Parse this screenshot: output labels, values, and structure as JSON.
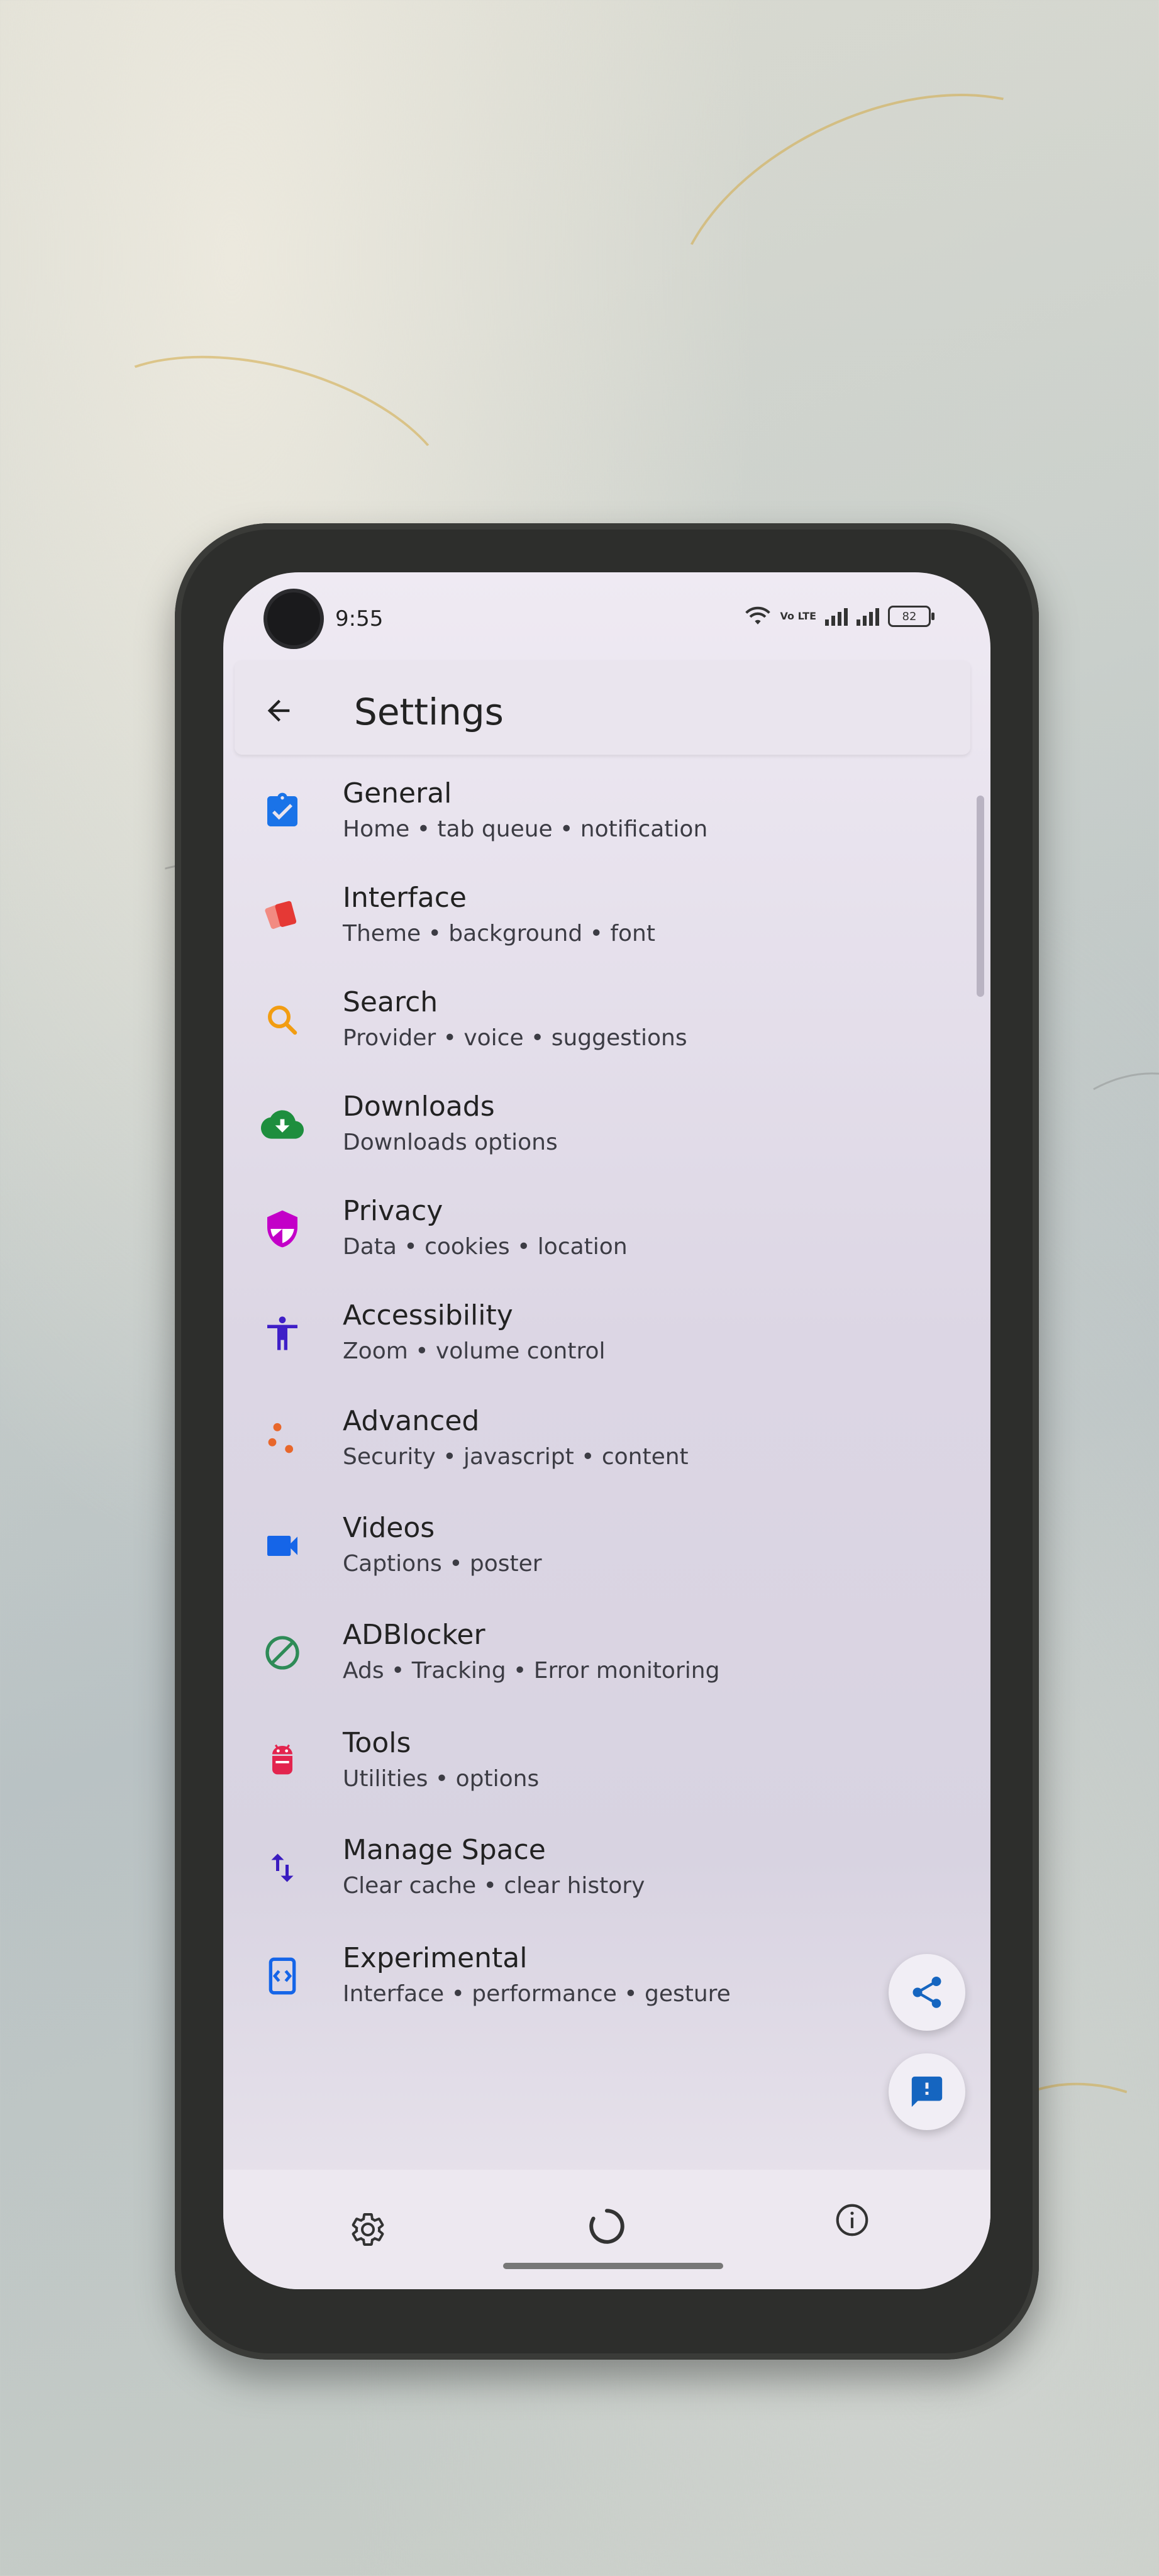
{
  "status_bar": {
    "time": "9:55",
    "network_label": "Vo LTE",
    "battery": "82"
  },
  "app_bar": {
    "title": "Settings",
    "back_icon": "arrow-back-icon"
  },
  "settings_items": [
    {
      "label": "General",
      "subtitle": "Home • tab queue • notification",
      "icon": "clipboard-check-icon",
      "color": "#1a73e8"
    },
    {
      "label": "Interface",
      "subtitle": "Theme • background • font",
      "icon": "palette-cards-icon",
      "color": "#e53935"
    },
    {
      "label": "Search",
      "subtitle": "Provider • voice • suggestions",
      "icon": "search-icon",
      "color": "#f29d12"
    },
    {
      "label": "Downloads",
      "subtitle": "Downloads options",
      "icon": "cloud-download-icon",
      "color": "#1e8e3e"
    },
    {
      "label": "Privacy",
      "subtitle": "Data • cookies • location",
      "icon": "shield-icon",
      "color": "#c300c8"
    },
    {
      "label": "Accessibility",
      "subtitle": "Zoom • volume control",
      "icon": "accessibility-icon",
      "color": "#3f1fc7"
    },
    {
      "label": "Advanced",
      "subtitle": "Security • javascript • content",
      "icon": "dots-icon",
      "color": "#e8672b"
    },
    {
      "label": "Videos",
      "subtitle": "Captions • poster",
      "icon": "videocam-icon",
      "color": "#1565e8"
    },
    {
      "label": "ADBlocker",
      "subtitle": "Ads • Tracking • Error monitoring",
      "icon": "block-icon",
      "color": "#2e8b57"
    },
    {
      "label": "Tools",
      "subtitle": "Utilities • options",
      "icon": "android-icon",
      "color": "#e3244e"
    },
    {
      "label": "Manage Space",
      "subtitle": "Clear cache • clear history",
      "icon": "swap-vert-icon",
      "color": "#3a1cc0"
    },
    {
      "label": "Experimental",
      "subtitle": "Interface • performance • gesture",
      "icon": "code-phone-icon",
      "color": "#1565e8"
    }
  ],
  "fabs": {
    "share_icon": "share-icon",
    "feedback_icon": "feedback-icon",
    "accent": "#1565c0"
  },
  "bottom_nav": {
    "settings_icon": "gear-icon",
    "loading_icon": "loading-spinner-icon",
    "info_icon": "info-icon"
  }
}
